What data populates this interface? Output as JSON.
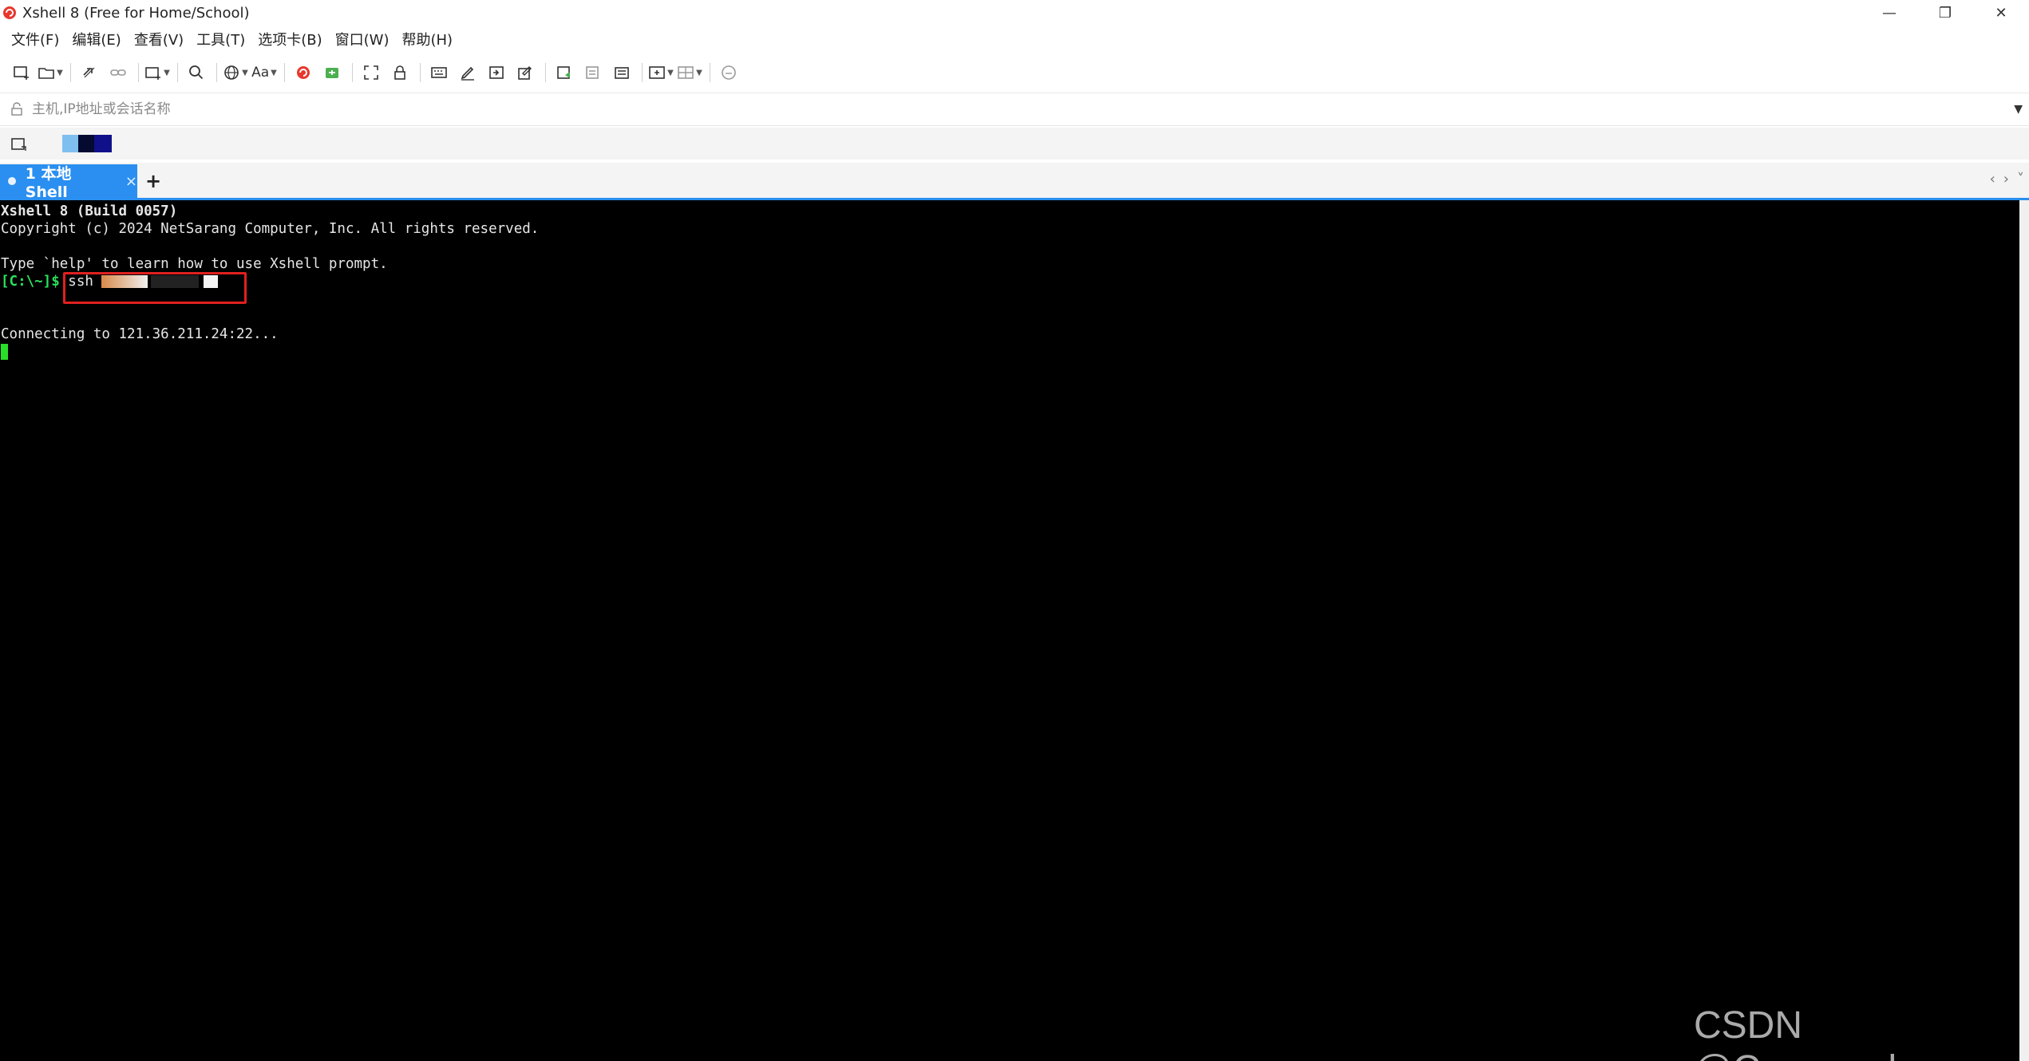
{
  "window": {
    "title": "Xshell 8 (Free for Home/School)",
    "minimize": "—",
    "restore": "❐",
    "close": "✕"
  },
  "menu": [
    "文件(F)",
    "编辑(E)",
    "查看(V)",
    "工具(T)",
    "选项卡(B)",
    "窗口(W)",
    "帮助(H)"
  ],
  "toolbar": {
    "font_label": "Aa"
  },
  "address": {
    "placeholder": "主机,IP地址或会话名称",
    "value": ""
  },
  "tabs": [
    {
      "label": "1 本地Shell",
      "close": "×"
    }
  ],
  "tab_add": "+",
  "tab_nav": {
    "prev": "‹",
    "next": "›",
    "menu": "˅"
  },
  "terminal": {
    "line1": "Xshell 8 (Build 0057)",
    "line2": "Copyright (c) 2024 NetSarang Computer, Inc. All rights reserved.",
    "line3": "Type `help' to learn how to use Xshell prompt.",
    "prompt": "[C:\\~]$ ",
    "command": "ssh ",
    "line5": "Connecting to 121.36.211.24:22..."
  },
  "colors": {
    "accent": "#2a8ff0",
    "terminal_bg": "#000000",
    "prompt": "#28e05a",
    "highlight_box": "#e02020"
  },
  "watermark": "CSDN @Crossoads"
}
